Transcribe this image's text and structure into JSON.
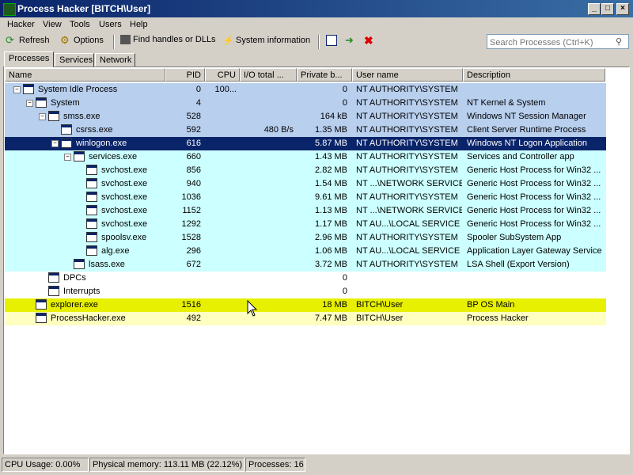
{
  "window": {
    "title": "Process Hacker [BITCH\\User]"
  },
  "menu": [
    "Hacker",
    "View",
    "Tools",
    "Users",
    "Help"
  ],
  "toolbar": {
    "refresh": "Refresh",
    "options": "Options",
    "find": "Find handles or DLLs",
    "sysinfo": "System information"
  },
  "search": {
    "placeholder": "Search Processes (Ctrl+K)"
  },
  "tabs": [
    "Processes",
    "Services",
    "Network"
  ],
  "columns": [
    "Name",
    "PID",
    "CPU",
    "I/O total ...",
    "Private b...",
    "User name",
    "Description"
  ],
  "rows": [
    {
      "name": "System Idle Process",
      "pid": "0",
      "cpu": "100...",
      "io": "",
      "priv": "0",
      "user": "NT AUTHORITY\\SYSTEM",
      "desc": "",
      "color": "#b8cfee",
      "level": 0,
      "exp": "−"
    },
    {
      "name": "System",
      "pid": "4",
      "cpu": "",
      "io": "",
      "priv": "0",
      "user": "NT AUTHORITY\\SYSTEM",
      "desc": "NT Kernel & System",
      "color": "#b8cfee",
      "level": 1,
      "exp": "−"
    },
    {
      "name": "smss.exe",
      "pid": "528",
      "cpu": "",
      "io": "",
      "priv": "164 kB",
      "user": "NT AUTHORITY\\SYSTEM",
      "desc": "Windows NT Session Manager",
      "color": "#b8cfee",
      "level": 2,
      "exp": "−"
    },
    {
      "name": "csrss.exe",
      "pid": "592",
      "cpu": "",
      "io": "480 B/s",
      "priv": "1.35 MB",
      "user": "NT AUTHORITY\\SYSTEM",
      "desc": "Client Server Runtime Process",
      "color": "#b8cfee",
      "level": 3,
      "exp": ""
    },
    {
      "name": "winlogon.exe",
      "pid": "616",
      "cpu": "",
      "io": "",
      "priv": "5.87 MB",
      "user": "NT AUTHORITY\\SYSTEM",
      "desc": "Windows NT Logon Application",
      "color": "#0a246a",
      "level": 3,
      "exp": "−",
      "selected": true
    },
    {
      "name": "services.exe",
      "pid": "660",
      "cpu": "",
      "io": "",
      "priv": "1.43 MB",
      "user": "NT AUTHORITY\\SYSTEM",
      "desc": "Services and Controller app",
      "color": "#ccffff",
      "level": 4,
      "exp": "−"
    },
    {
      "name": "svchost.exe",
      "pid": "856",
      "cpu": "",
      "io": "",
      "priv": "2.82 MB",
      "user": "NT AUTHORITY\\SYSTEM",
      "desc": "Generic Host Process for Win32 ...",
      "color": "#ccffff",
      "level": 5,
      "exp": ""
    },
    {
      "name": "svchost.exe",
      "pid": "940",
      "cpu": "",
      "io": "",
      "priv": "1.54 MB",
      "user": "NT ...\\NETWORK SERVICE",
      "desc": "Generic Host Process for Win32 ...",
      "color": "#ccffff",
      "level": 5,
      "exp": ""
    },
    {
      "name": "svchost.exe",
      "pid": "1036",
      "cpu": "",
      "io": "",
      "priv": "9.61 MB",
      "user": "NT AUTHORITY\\SYSTEM",
      "desc": "Generic Host Process for Win32 ...",
      "color": "#ccffff",
      "level": 5,
      "exp": ""
    },
    {
      "name": "svchost.exe",
      "pid": "1152",
      "cpu": "",
      "io": "",
      "priv": "1.13 MB",
      "user": "NT ...\\NETWORK SERVICE",
      "desc": "Generic Host Process for Win32 ...",
      "color": "#ccffff",
      "level": 5,
      "exp": ""
    },
    {
      "name": "svchost.exe",
      "pid": "1292",
      "cpu": "",
      "io": "",
      "priv": "1.17 MB",
      "user": "NT AU...\\LOCAL SERVICE",
      "desc": "Generic Host Process for Win32 ...",
      "color": "#ccffff",
      "level": 5,
      "exp": ""
    },
    {
      "name": "spoolsv.exe",
      "pid": "1528",
      "cpu": "",
      "io": "",
      "priv": "2.96 MB",
      "user": "NT AUTHORITY\\SYSTEM",
      "desc": "Spooler SubSystem App",
      "color": "#ccffff",
      "level": 5,
      "exp": ""
    },
    {
      "name": "alg.exe",
      "pid": "296",
      "cpu": "",
      "io": "",
      "priv": "1.06 MB",
      "user": "NT AU...\\LOCAL SERVICE",
      "desc": "Application Layer Gateway Service",
      "color": "#ccffff",
      "level": 5,
      "exp": ""
    },
    {
      "name": "lsass.exe",
      "pid": "672",
      "cpu": "",
      "io": "",
      "priv": "3.72 MB",
      "user": "NT AUTHORITY\\SYSTEM",
      "desc": "LSA Shell (Export Version)",
      "color": "#ccffff",
      "level": 4,
      "exp": ""
    },
    {
      "name": "DPCs",
      "pid": "",
      "cpu": "",
      "io": "",
      "priv": "0",
      "user": "",
      "desc": "",
      "color": "#ffffff",
      "level": 2,
      "exp": ""
    },
    {
      "name": "Interrupts",
      "pid": "",
      "cpu": "",
      "io": "",
      "priv": "0",
      "user": "",
      "desc": "",
      "color": "#ffffff",
      "level": 2,
      "exp": ""
    },
    {
      "name": "explorer.exe",
      "pid": "1516",
      "cpu": "",
      "io": "",
      "priv": "18 MB",
      "user": "BITCH\\User",
      "desc": "BP OS Main",
      "color": "#e6f000",
      "level": 1,
      "exp": ""
    },
    {
      "name": "ProcessHacker.exe",
      "pid": "492",
      "cpu": "",
      "io": "",
      "priv": "7.47 MB",
      "user": "BITCH\\User",
      "desc": "Process Hacker",
      "color": "#ffffc0",
      "level": 1,
      "exp": ""
    }
  ],
  "status": {
    "cpu": "CPU Usage: 0.00%",
    "mem": "Physical memory: 113.11 MB (22.12%)",
    "procs": "Processes: 16"
  }
}
